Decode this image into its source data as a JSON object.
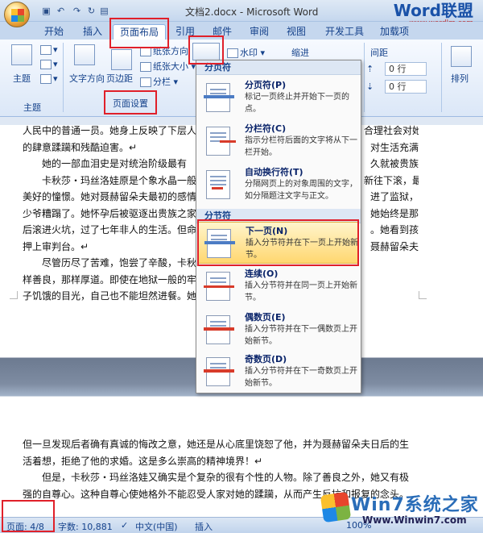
{
  "window": {
    "title": "文档2.docx - Microsoft Word"
  },
  "brand": {
    "name": "Word联盟",
    "url": "www.wordlm.com"
  },
  "tabs": [
    {
      "label": "开始"
    },
    {
      "label": "插入"
    },
    {
      "label": "页面布局"
    },
    {
      "label": "引用"
    },
    {
      "label": "邮件"
    },
    {
      "label": "审阅"
    },
    {
      "label": "视图"
    },
    {
      "label": "开发工具"
    },
    {
      "label": "加载项"
    }
  ],
  "ribbon": {
    "themes": {
      "main": "主题",
      "group": "主题"
    },
    "page_setup": {
      "text_dir": "文字方向",
      "margins": "页边距",
      "orientation": "纸张方向",
      "size": "纸张大小",
      "columns": "分栏",
      "group": "页面设置"
    },
    "watermark": "水印",
    "indent": "缩进",
    "spacing": {
      "label": "间距",
      "before": "0 行",
      "after": "0 行"
    },
    "arrange": "排列"
  },
  "menu": {
    "section1": "分页符",
    "section2": "分节符",
    "items": [
      {
        "title": "分页符(P)",
        "desc": "标记一页终止并开始下一页的点。"
      },
      {
        "title": "分栏符(C)",
        "desc": "指示分栏符后面的文字将从下一栏开始。"
      },
      {
        "title": "自动换行符(T)",
        "desc": "分隔网页上的对象周围的文字，如分隔题注文字与正文。"
      },
      {
        "title": "下一页(N)",
        "desc": "插入分节符并在下一页上开始新节。"
      },
      {
        "title": "连续(O)",
        "desc": "插入分节符并在同一页上开始新节。"
      },
      {
        "title": "偶数页(E)",
        "desc": "插入分节符并在下一偶数页上开始新节。"
      },
      {
        "title": "奇数页(D)",
        "desc": "插入分节符并在下一奇数页上开始新节。"
      }
    ]
  },
  "doc": {
    "page1": [
      {
        "left": "人民中的普通一员。她身上反映了下层人",
        "right": "合理社会对她"
      },
      {
        "left": "的肆意蹂躏和残酷迫害。↵",
        "right": ""
      },
      {
        "left": "　　她的一部血泪史是对统治阶级最有",
        "right": ""
      },
      {
        "left": "　　卡秋莎・玛丝洛娃原是个象水晶一般",
        "right": "对生活充满"
      },
      {
        "left": "美好的憧憬。她对聂赫留朵夫最初的感情",
        "right": "久就被贵族"
      },
      {
        "left": "少爷糟蹋了。她怀孕后被驱逐出贵族之家",
        "right": "新往下滚，最"
      },
      {
        "left": "后滚进火坑，过了七年非人的生活。但命",
        "right": "进了监狱，"
      },
      {
        "left": "押上审判台。↵",
        "right": ""
      },
      {
        "left": "　　尽管历尽了苦难，饱尝了辛酸，卡秋",
        "right": "她始终是那"
      },
      {
        "left": "样善良，那样厚道。即使在地狱一般的牢",
        "right": "。她看到孩"
      },
      {
        "left": "子饥饿的目光，自己也不能坦然进餐。她",
        "right": "聂赫留朵夫"
      }
    ],
    "page2": [
      "但一旦发现后者确有真诚的悔改之意，她还是从心底里饶恕了他，并为聂赫留朵夫日后的生",
      "活着想，拒绝了他的求婚。这是多么崇高的精神境界！↵",
      "　　但是，卡秋莎・玛丝洛娃又确实是个复杂的很有个性的人物。除了善良之外，她又有极",
      "强的自尊心。这种自尊心使她格外不能忍受人家对她的蹂躏，从而产生反抗和报复的念头。"
    ]
  },
  "status": {
    "page": "页面: 4/8",
    "words": "字数: 10,881",
    "lang": "中文(中国)",
    "mode": "插入",
    "zoom": "100%"
  },
  "site_watermark": {
    "title": "Win7系统之家",
    "url": "Www.Winwin7.com"
  }
}
